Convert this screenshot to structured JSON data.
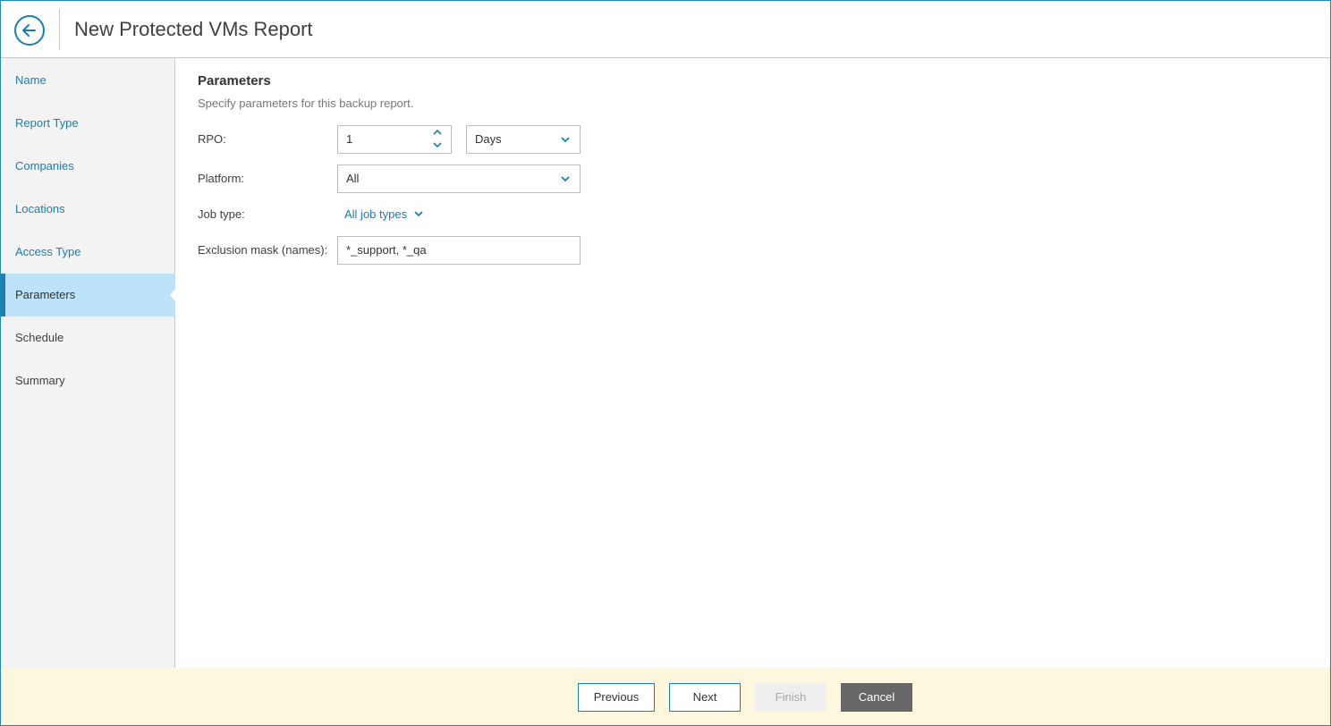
{
  "header": {
    "title": "New Protected VMs Report",
    "back_icon": "arrow-left-icon"
  },
  "sidebar": {
    "items": [
      {
        "label": "Name",
        "state": "done"
      },
      {
        "label": "Report Type",
        "state": "done"
      },
      {
        "label": "Companies",
        "state": "done"
      },
      {
        "label": "Locations",
        "state": "done"
      },
      {
        "label": "Access Type",
        "state": "done"
      },
      {
        "label": "Parameters",
        "state": "active"
      },
      {
        "label": "Schedule",
        "state": "pending"
      },
      {
        "label": "Summary",
        "state": "pending"
      }
    ]
  },
  "main": {
    "title": "Parameters",
    "description": "Specify parameters for this backup report.",
    "rpo": {
      "label": "RPO:",
      "value": "1",
      "unit": "Days"
    },
    "platform": {
      "label": "Platform:",
      "value": "All"
    },
    "job_type": {
      "label": "Job type:",
      "value": "All job types"
    },
    "exclusion_mask": {
      "label": "Exclusion mask (names):",
      "value": "*_support, *_qa"
    }
  },
  "footer": {
    "previous_label": "Previous",
    "next_label": "Next",
    "finish_label": "Finish",
    "cancel_label": "Cancel"
  },
  "colors": {
    "accent": "#1a7fae",
    "active_nav_bg": "#bde3fb",
    "footer_bg": "#fdf8dd",
    "cancel_bg": "#666666"
  }
}
